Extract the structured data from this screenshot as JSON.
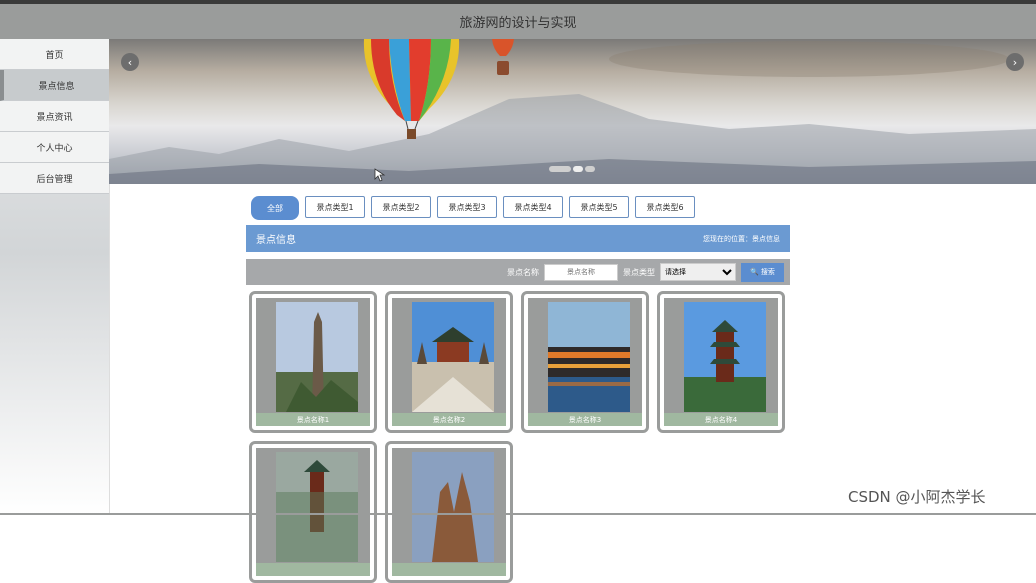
{
  "header": {
    "title": "旅游网的设计与实现"
  },
  "sidebar": {
    "items": [
      {
        "label": "首页"
      },
      {
        "label": "景点信息"
      },
      {
        "label": "景点资讯"
      },
      {
        "label": "个人中心"
      },
      {
        "label": "后台管理"
      }
    ],
    "active_index": 1
  },
  "banner": {
    "prev_icon": "‹",
    "next_icon": "›",
    "active_slide": 2,
    "slide_count": 3
  },
  "tabs": [
    "全部",
    "景点类型1",
    "景点类型2",
    "景点类型3",
    "景点类型4",
    "景点类型5",
    "景点类型6"
  ],
  "section": {
    "title": "景点信息",
    "location": "您现在的位置：景点信息"
  },
  "search": {
    "name_label": "景点名称",
    "name_placeholder": "景点名称",
    "type_label": "景点类型",
    "type_selected": "请选择",
    "button_label": "搜索",
    "button_icon": "🔍"
  },
  "cards": [
    {
      "name": "景点名称1"
    },
    {
      "name": "景点名称2"
    },
    {
      "name": "景点名称3"
    },
    {
      "name": "景点名称4"
    },
    {
      "name": ""
    },
    {
      "name": ""
    }
  ],
  "watermark": "CSDN @小阿杰学长",
  "colors": {
    "header_bg": "#9a9c9b",
    "accent": "#5b8dd0",
    "section_bar": "#6b9ad2",
    "card_label": "#a0b8a0"
  }
}
